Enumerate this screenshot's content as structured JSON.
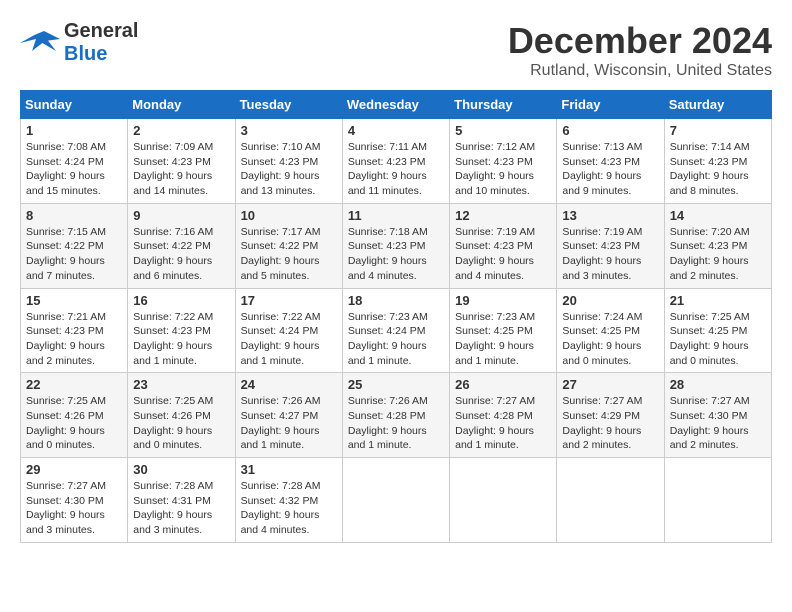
{
  "header": {
    "logo_line1": "General",
    "logo_line2": "Blue",
    "month": "December 2024",
    "location": "Rutland, Wisconsin, United States"
  },
  "weekdays": [
    "Sunday",
    "Monday",
    "Tuesday",
    "Wednesday",
    "Thursday",
    "Friday",
    "Saturday"
  ],
  "weeks": [
    [
      {
        "day": "1",
        "sunrise": "7:08 AM",
        "sunset": "4:24 PM",
        "daylight": "9 hours and 15 minutes."
      },
      {
        "day": "2",
        "sunrise": "7:09 AM",
        "sunset": "4:23 PM",
        "daylight": "9 hours and 14 minutes."
      },
      {
        "day": "3",
        "sunrise": "7:10 AM",
        "sunset": "4:23 PM",
        "daylight": "9 hours and 13 minutes."
      },
      {
        "day": "4",
        "sunrise": "7:11 AM",
        "sunset": "4:23 PM",
        "daylight": "9 hours and 11 minutes."
      },
      {
        "day": "5",
        "sunrise": "7:12 AM",
        "sunset": "4:23 PM",
        "daylight": "9 hours and 10 minutes."
      },
      {
        "day": "6",
        "sunrise": "7:13 AM",
        "sunset": "4:23 PM",
        "daylight": "9 hours and 9 minutes."
      },
      {
        "day": "7",
        "sunrise": "7:14 AM",
        "sunset": "4:23 PM",
        "daylight": "9 hours and 8 minutes."
      }
    ],
    [
      {
        "day": "8",
        "sunrise": "7:15 AM",
        "sunset": "4:22 PM",
        "daylight": "9 hours and 7 minutes."
      },
      {
        "day": "9",
        "sunrise": "7:16 AM",
        "sunset": "4:22 PM",
        "daylight": "9 hours and 6 minutes."
      },
      {
        "day": "10",
        "sunrise": "7:17 AM",
        "sunset": "4:22 PM",
        "daylight": "9 hours and 5 minutes."
      },
      {
        "day": "11",
        "sunrise": "7:18 AM",
        "sunset": "4:23 PM",
        "daylight": "9 hours and 4 minutes."
      },
      {
        "day": "12",
        "sunrise": "7:19 AM",
        "sunset": "4:23 PM",
        "daylight": "9 hours and 4 minutes."
      },
      {
        "day": "13",
        "sunrise": "7:19 AM",
        "sunset": "4:23 PM",
        "daylight": "9 hours and 3 minutes."
      },
      {
        "day": "14",
        "sunrise": "7:20 AM",
        "sunset": "4:23 PM",
        "daylight": "9 hours and 2 minutes."
      }
    ],
    [
      {
        "day": "15",
        "sunrise": "7:21 AM",
        "sunset": "4:23 PM",
        "daylight": "9 hours and 2 minutes."
      },
      {
        "day": "16",
        "sunrise": "7:22 AM",
        "sunset": "4:23 PM",
        "daylight": "9 hours and 1 minute."
      },
      {
        "day": "17",
        "sunrise": "7:22 AM",
        "sunset": "4:24 PM",
        "daylight": "9 hours and 1 minute."
      },
      {
        "day": "18",
        "sunrise": "7:23 AM",
        "sunset": "4:24 PM",
        "daylight": "9 hours and 1 minute."
      },
      {
        "day": "19",
        "sunrise": "7:23 AM",
        "sunset": "4:25 PM",
        "daylight": "9 hours and 1 minute."
      },
      {
        "day": "20",
        "sunrise": "7:24 AM",
        "sunset": "4:25 PM",
        "daylight": "9 hours and 0 minutes."
      },
      {
        "day": "21",
        "sunrise": "7:25 AM",
        "sunset": "4:25 PM",
        "daylight": "9 hours and 0 minutes."
      }
    ],
    [
      {
        "day": "22",
        "sunrise": "7:25 AM",
        "sunset": "4:26 PM",
        "daylight": "9 hours and 0 minutes."
      },
      {
        "day": "23",
        "sunrise": "7:25 AM",
        "sunset": "4:26 PM",
        "daylight": "9 hours and 0 minutes."
      },
      {
        "day": "24",
        "sunrise": "7:26 AM",
        "sunset": "4:27 PM",
        "daylight": "9 hours and 1 minute."
      },
      {
        "day": "25",
        "sunrise": "7:26 AM",
        "sunset": "4:28 PM",
        "daylight": "9 hours and 1 minute."
      },
      {
        "day": "26",
        "sunrise": "7:27 AM",
        "sunset": "4:28 PM",
        "daylight": "9 hours and 1 minute."
      },
      {
        "day": "27",
        "sunrise": "7:27 AM",
        "sunset": "4:29 PM",
        "daylight": "9 hours and 2 minutes."
      },
      {
        "day": "28",
        "sunrise": "7:27 AM",
        "sunset": "4:30 PM",
        "daylight": "9 hours and 2 minutes."
      }
    ],
    [
      {
        "day": "29",
        "sunrise": "7:27 AM",
        "sunset": "4:30 PM",
        "daylight": "9 hours and 3 minutes."
      },
      {
        "day": "30",
        "sunrise": "7:28 AM",
        "sunset": "4:31 PM",
        "daylight": "9 hours and 3 minutes."
      },
      {
        "day": "31",
        "sunrise": "7:28 AM",
        "sunset": "4:32 PM",
        "daylight": "9 hours and 4 minutes."
      },
      null,
      null,
      null,
      null
    ]
  ],
  "labels": {
    "sunrise": "Sunrise:",
    "sunset": "Sunset:",
    "daylight": "Daylight:"
  }
}
